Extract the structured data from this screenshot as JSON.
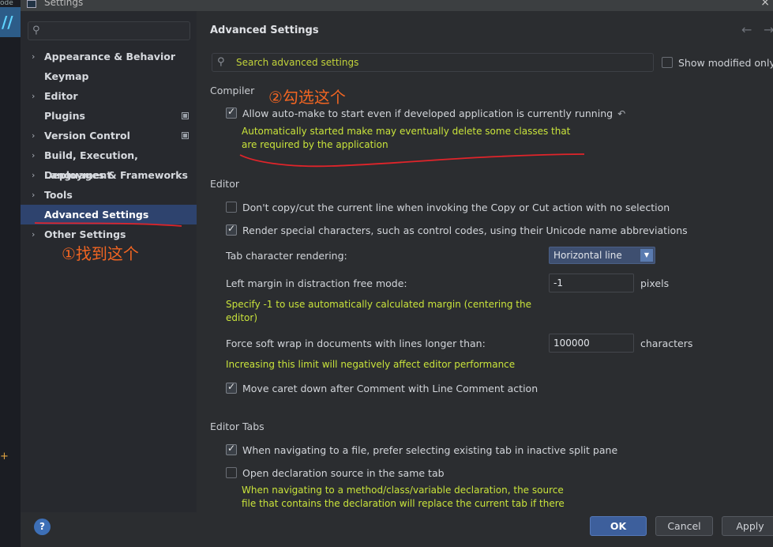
{
  "edge": {
    "top_text": "ode",
    "tab_glyph": "//",
    "mark": "+"
  },
  "window": {
    "title": "Settings",
    "close_glyph": "×"
  },
  "sidebar": {
    "search_placeholder": "",
    "items": [
      {
        "label": "Appearance & Behavior",
        "expandable": true,
        "badge": false,
        "selected": false
      },
      {
        "label": "Keymap",
        "expandable": false,
        "badge": false,
        "selected": false
      },
      {
        "label": "Editor",
        "expandable": true,
        "badge": false,
        "selected": false
      },
      {
        "label": "Plugins",
        "expandable": false,
        "badge": true,
        "selected": false
      },
      {
        "label": "Version Control",
        "expandable": true,
        "badge": true,
        "selected": false
      },
      {
        "label": "Build, Execution, Deployment",
        "expandable": true,
        "badge": false,
        "selected": false
      },
      {
        "label": "Languages & Frameworks",
        "expandable": true,
        "badge": false,
        "selected": false
      },
      {
        "label": "Tools",
        "expandable": true,
        "badge": false,
        "selected": false
      },
      {
        "label": "Advanced Settings",
        "expandable": false,
        "badge": false,
        "selected": true
      },
      {
        "label": "Other Settings",
        "expandable": true,
        "badge": false,
        "selected": false
      }
    ]
  },
  "annotations": {
    "step1": "①找到这个",
    "step2": "②勾选这个",
    "color": "#f26522"
  },
  "main": {
    "title": "Advanced Settings",
    "search_placeholder": "Search advanced settings",
    "show_modified_label": "Show modified only",
    "compiler": {
      "title": "Compiler",
      "auto_make_label": "Allow auto-make to start even if developed application is currently running",
      "auto_make_checked": true,
      "auto_make_hint_line1": "Automatically started make may eventually delete some classes that",
      "auto_make_hint_line2": "are required by the application"
    },
    "editor": {
      "title": "Editor",
      "no_copy_label": "Don't copy/cut the current line when invoking the Copy or Cut action with no selection",
      "no_copy_checked": false,
      "render_special_label": "Render special characters, such as control codes, using their Unicode name abbreviations",
      "render_special_checked": true,
      "tab_render_label": "Tab character rendering:",
      "tab_render_value": "Horizontal line",
      "left_margin_label": "Left margin in distraction free mode:",
      "left_margin_value": "-1",
      "left_margin_unit": "pixels",
      "left_margin_hint_line1": "Specify -1 to use automatically calculated margin (centering the",
      "left_margin_hint_line2": "editor)",
      "soft_wrap_label": "Force soft wrap in documents with lines longer than:",
      "soft_wrap_value": "100000",
      "soft_wrap_unit": "characters",
      "soft_wrap_hint": "Increasing this limit will negatively affect editor performance",
      "move_caret_label": "Move caret down after Comment with Line Comment action",
      "move_caret_checked": true
    },
    "editor_tabs": {
      "title": "Editor Tabs",
      "prefer_existing_label": "When navigating to a file, prefer selecting existing tab in inactive split pane",
      "prefer_existing_checked": true,
      "open_decl_label": "Open declaration source in the same tab",
      "open_decl_checked": false,
      "open_decl_hint_line1": "When navigating to a method/class/variable declaration, the source",
      "open_decl_hint_line2": "file that contains the declaration will replace the current tab if there"
    }
  },
  "footer": {
    "help": "?",
    "ok": "OK",
    "cancel": "Cancel",
    "apply": "Apply"
  }
}
